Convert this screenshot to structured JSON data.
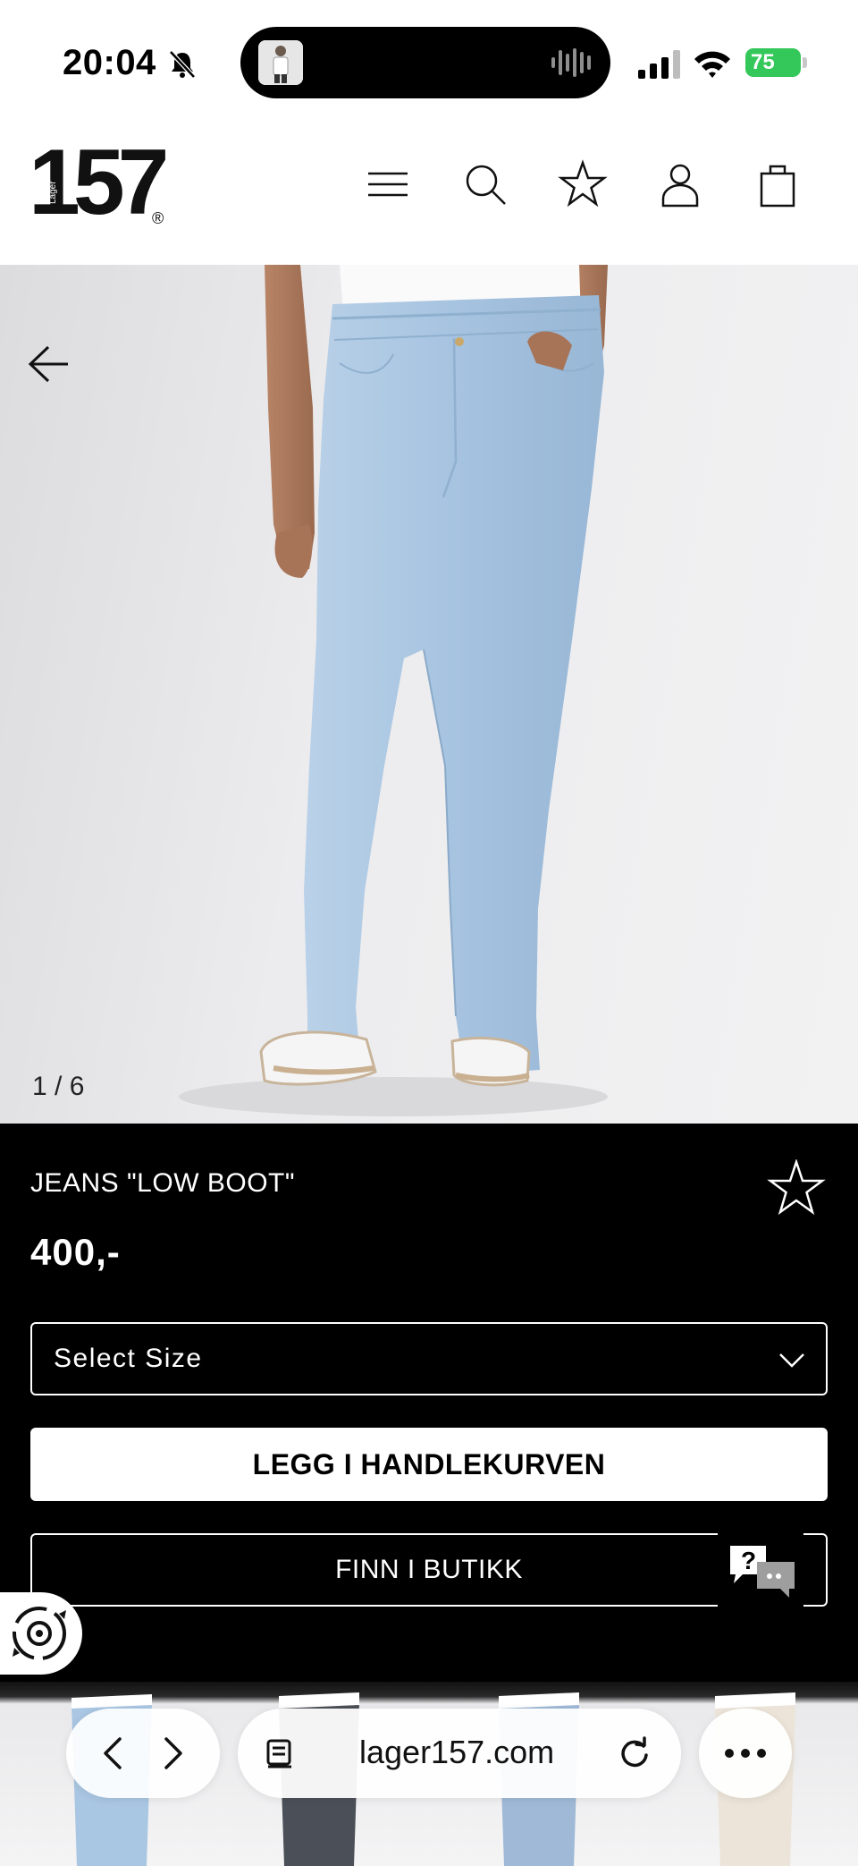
{
  "status_bar": {
    "time": "20:04",
    "battery": "75"
  },
  "header": {
    "logo_number": "157",
    "logo_word": "Lager",
    "logo_mark": "®",
    "icons": [
      "menu-icon",
      "search-icon",
      "star-icon",
      "user-icon",
      "bag-icon"
    ]
  },
  "gallery": {
    "counter": "1 / 6",
    "current_index": 1,
    "total": 6
  },
  "product": {
    "name": "JEANS \"LOW BOOT\"",
    "price": "400,-",
    "size_select": "Select Size",
    "add_to_cart": "LEGG I HANDLEKURVEN",
    "find_in_store": "FINN I BUTIKK"
  },
  "browser": {
    "url": "lager157.com"
  },
  "colors": {
    "battery_green": "#34c759",
    "panel_bg": "#000000",
    "denim": "#a9c6e2"
  }
}
